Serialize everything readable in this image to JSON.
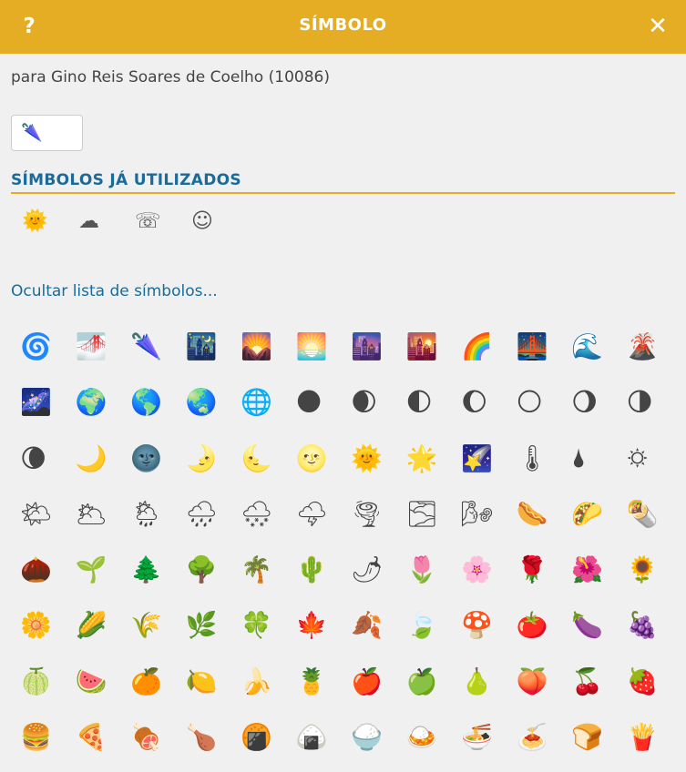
{
  "dialog": {
    "help_label": "?",
    "title": "SÍMBOLO",
    "close_label": "✕"
  },
  "recipient": "para Gino Reis Soares de Coelho (10086)",
  "current_symbol": "🌂",
  "used_section": {
    "title": "SÍMBOLOS JÁ UTILIZADOS",
    "symbols": [
      "🌞",
      "☁",
      "☏",
      "☺"
    ]
  },
  "toggle_link": "Ocultar lista de símbolos...",
  "symbol_grid": [
    "🌀",
    "🌁",
    "🌂",
    "🌃",
    "🌄",
    "🌅",
    "🌆",
    "🌇",
    "🌈",
    "🌉",
    "🌊",
    "🌋",
    "🌌",
    "🌍",
    "🌎",
    "🌏",
    "🌐",
    "🌑",
    "🌒",
    "🌓",
    "🌔",
    "🌕",
    "🌖",
    "🌗",
    "🌘",
    "🌙",
    "🌚",
    "🌛",
    "🌜",
    "🌝",
    "🌞",
    "🌟",
    "🌠",
    "🌡",
    "🌢",
    "🌣",
    "🌤",
    "🌥",
    "🌦",
    "🌧",
    "🌨",
    "🌩",
    "🌪",
    "🌫",
    "🌬",
    "🌭",
    "🌮",
    "🌯",
    "🌰",
    "🌱",
    "🌲",
    "🌳",
    "🌴",
    "🌵",
    "🌶",
    "🌷",
    "🌸",
    "🌹",
    "🌺",
    "🌻",
    "🌼",
    "🌽",
    "🌾",
    "🌿",
    "🍀",
    "🍁",
    "🍂",
    "🍃",
    "🍄",
    "🍅",
    "🍆",
    "🍇",
    "🍈",
    "🍉",
    "🍊",
    "🍋",
    "🍌",
    "🍍",
    "🍎",
    "🍏",
    "🍐",
    "🍑",
    "🍒",
    "🍓",
    "🍔",
    "🍕",
    "🍖",
    "🍗",
    "🍘",
    "🍙",
    "🍚",
    "🍛",
    "🍜",
    "🍝",
    "🍞",
    "🍟"
  ]
}
